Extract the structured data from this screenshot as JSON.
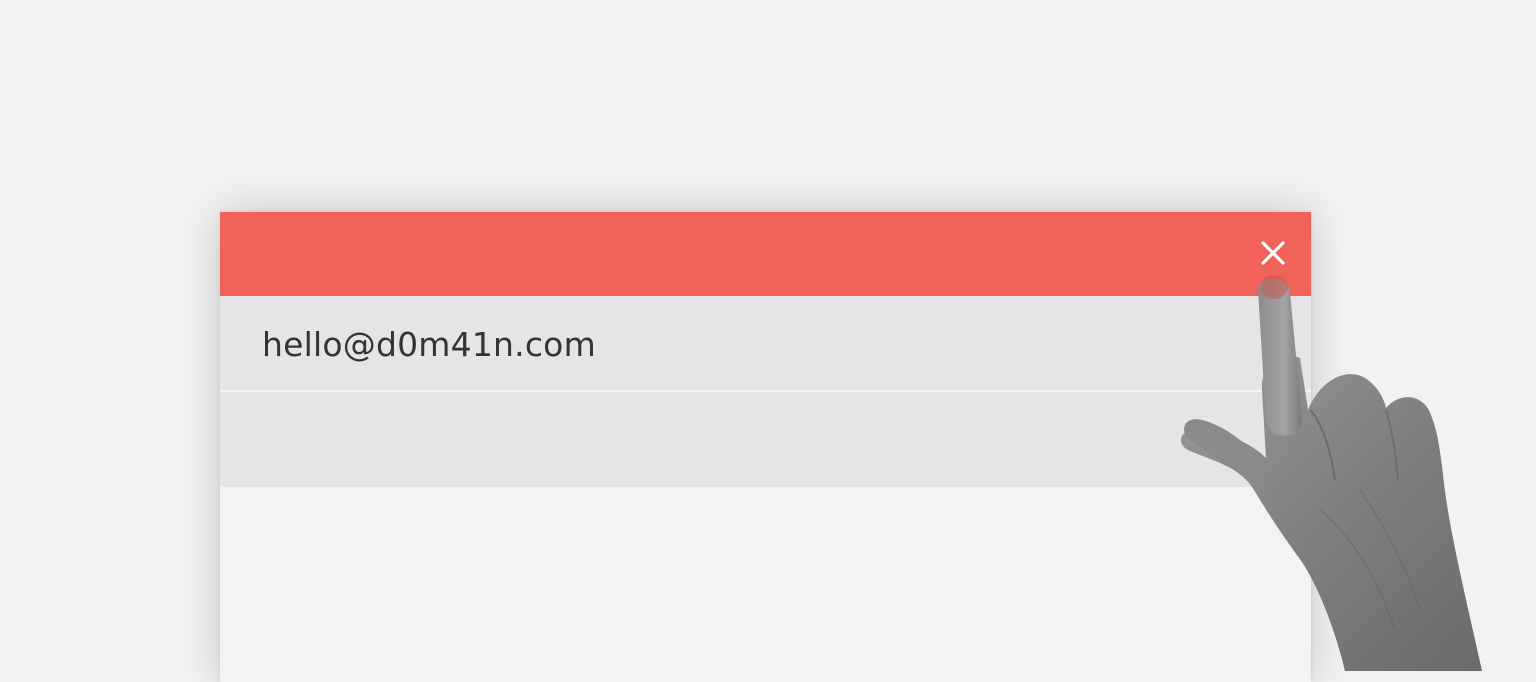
{
  "window": {
    "accent_color": "#f0625a",
    "close_icon": "close-icon"
  },
  "fields": {
    "email": {
      "value": "hello@d0m41n.com"
    },
    "second": {
      "value": ""
    }
  },
  "overlay": {
    "image": "pointing-hand"
  }
}
